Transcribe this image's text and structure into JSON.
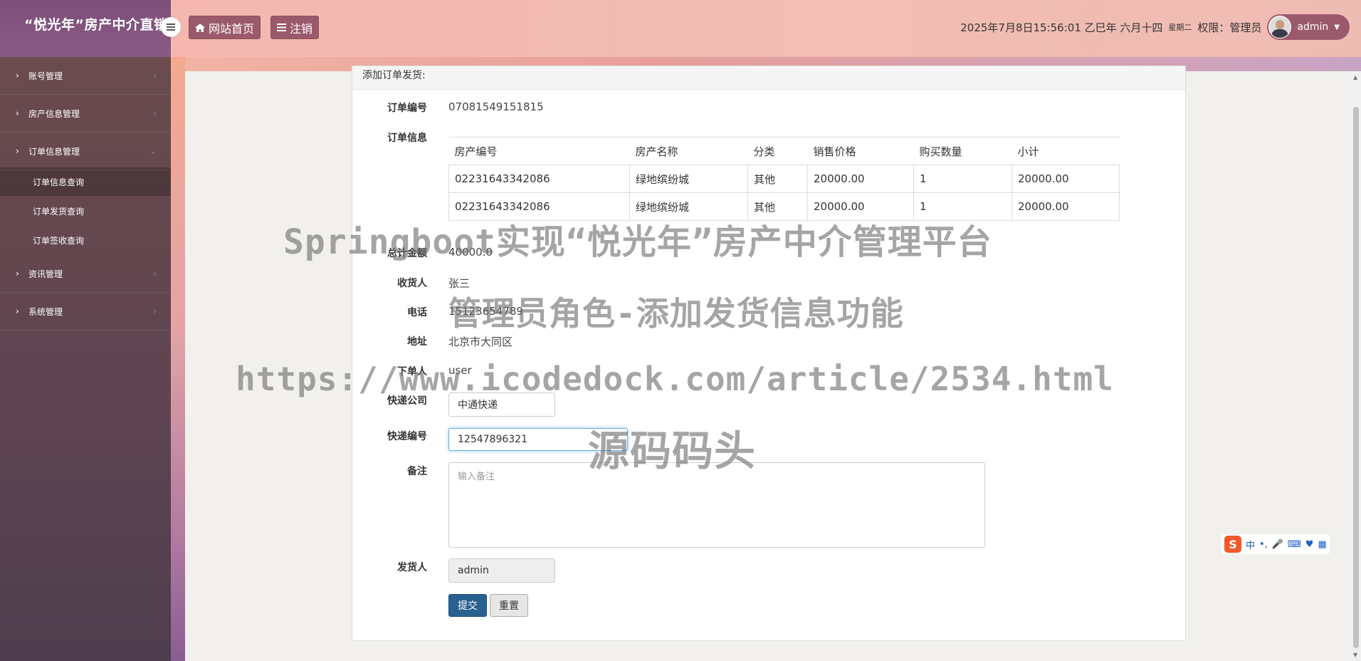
{
  "header": {
    "brand_title": "“悦光年”房产中介直销",
    "home_button": "网站首页",
    "logout_button": "注销",
    "datetime": "2025年7月8日15:56:01 乙巳年 六月十四",
    "weekday": "星期二",
    "role_label": "权限：管理员",
    "username": "admin"
  },
  "sidebar": {
    "items": [
      {
        "label": "账号管理"
      },
      {
        "label": "房产信息管理"
      },
      {
        "label": "订单信息管理"
      },
      {
        "label": "资讯管理"
      },
      {
        "label": "系统管理"
      }
    ],
    "subitems": [
      {
        "label": "订单信息查询"
      },
      {
        "label": "订单发货查询"
      },
      {
        "label": "订单签收查询"
      }
    ]
  },
  "form": {
    "panel_title": "添加订单发货:",
    "order_no_label": "订单编号",
    "order_no": "07081549151815",
    "order_info_label": "订单信息",
    "table_headers": [
      "房产编号",
      "房产名称",
      "分类",
      "销售价格",
      "购买数量",
      "小计"
    ],
    "rows": [
      [
        "02231643342086",
        "绿地缤纷城",
        "其他",
        "20000.00",
        "1",
        "20000.00"
      ],
      [
        "02231643342086",
        "绿地缤纷城",
        "其他",
        "20000.00",
        "1",
        "20000.00"
      ]
    ],
    "total_label": "总计金额",
    "total": "40000.0",
    "receiver_label": "收货人",
    "receiver": "张三",
    "phone_label": "电话",
    "phone": "15123654789",
    "address_label": "地址",
    "address": "北京市大同区",
    "orderer_label": "下单人",
    "orderer": "user",
    "express_company_label": "快递公司",
    "express_company": "中通快递",
    "express_no_label": "快递编号",
    "express_no": "12547896321",
    "remark_label": "备注",
    "remark_placeholder": "输入备注",
    "shipper_label": "发货人",
    "shipper": "admin",
    "submit_button": "提交",
    "reset_button": "重置"
  },
  "watermark": {
    "line1": "Springboot实现“悦光年”房产中介管理平台",
    "line2": "管理员角色-添加发货信息功能",
    "line3": "https://www.icodedock.com/article/2534.html",
    "line4": "源码码头"
  },
  "ime": {
    "logo": "S",
    "mode": "中"
  }
}
